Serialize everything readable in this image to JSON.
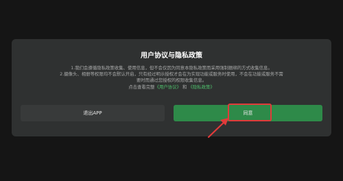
{
  "dialog": {
    "title": "用户协议与隐私政策",
    "line1": "1.我们会遵循隐私政策收集、使用信息，但不会仅因为同意本隐私政策而采用强制捆绑的方式收集信息。",
    "line2": "2.摄像头、相册等权限均不会默认开启，只有经过明示授权才会在为实现功能或服务时使用，不会在功能或服务不需",
    "line3": "要时而通过您授权的权限收集信息。",
    "view_prefix": "点击查看完整",
    "user_agreement_link": "《用户协议》",
    "and_text": "和",
    "privacy_policy_link": "《隐私政策》",
    "exit_button": "退出APP",
    "agree_button": "同意"
  },
  "colors": {
    "accent": "#2e8a49",
    "link": "#4fbf6c",
    "highlight": "#e23a3a"
  }
}
